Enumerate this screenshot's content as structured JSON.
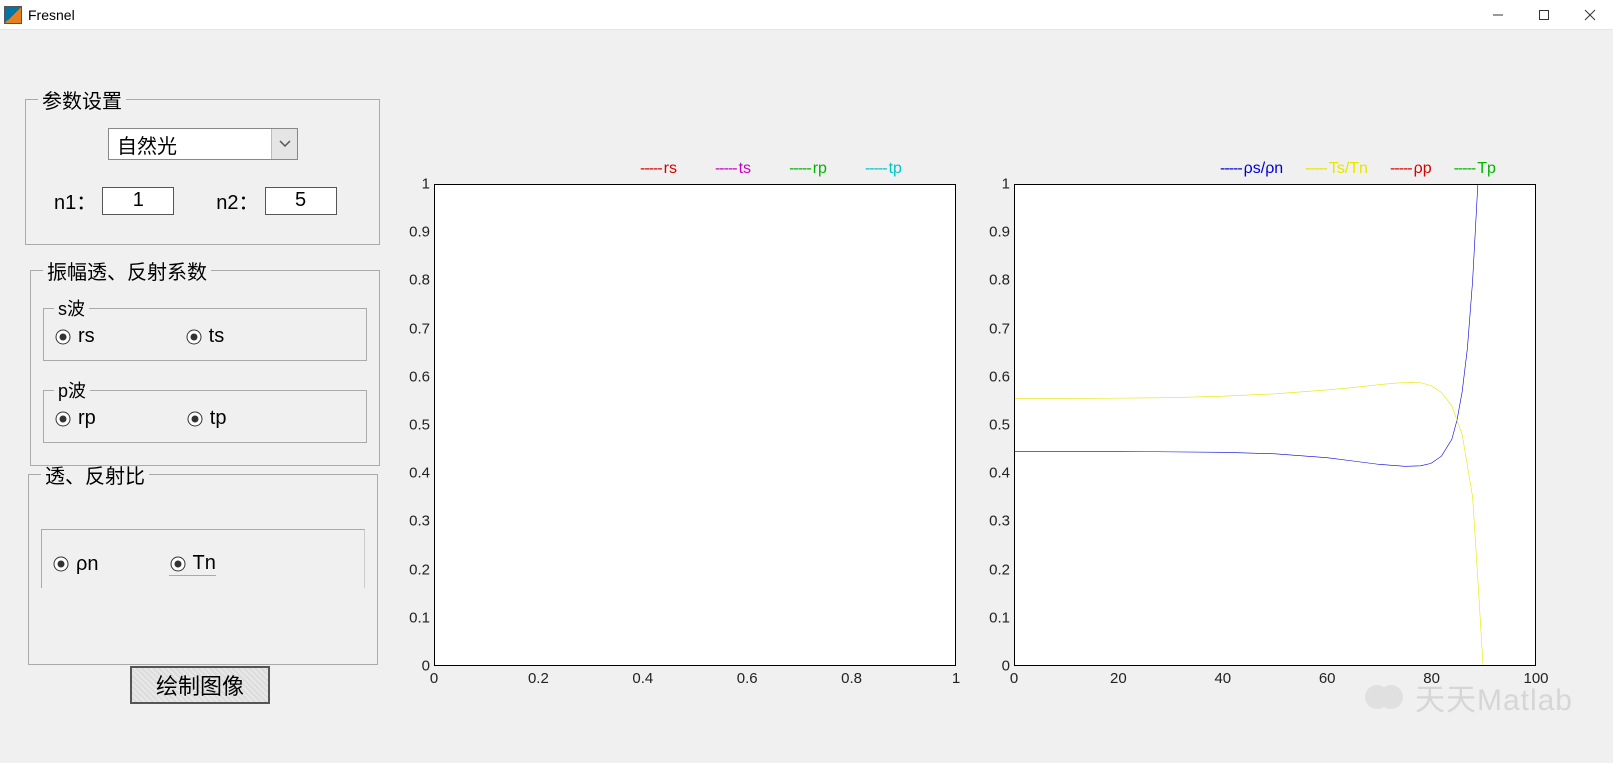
{
  "window": {
    "title": "Fresnel"
  },
  "params": {
    "legend": "参数设置",
    "light_type": "自然光",
    "n1_label": "n1：",
    "n1_value": "1",
    "n2_label": "n2：",
    "n2_value": "5"
  },
  "amp": {
    "legend": "振幅透、反射系数",
    "s_legend": "s波",
    "p_legend": "p波",
    "rs": "rs",
    "ts": "ts",
    "rp": "rp",
    "tp": "tp"
  },
  "ratio": {
    "legend": "透、反射比",
    "rho_n": "ρn",
    "Tn": "Tn"
  },
  "button": {
    "plot": "绘制图像"
  },
  "axes1": {
    "xticks": [
      "0",
      "0.2",
      "0.4",
      "0.6",
      "0.8",
      "1"
    ],
    "yticks": [
      "0",
      "0.1",
      "0.2",
      "0.3",
      "0.4",
      "0.5",
      "0.6",
      "0.7",
      "0.8",
      "0.9",
      "1"
    ],
    "legend": [
      {
        "label": "rs",
        "color": "#d80000"
      },
      {
        "label": "ts",
        "color": "#c400c4"
      },
      {
        "label": "rp",
        "color": "#00b400"
      },
      {
        "label": "tp",
        "color": "#00c5c5"
      }
    ]
  },
  "axes2": {
    "xticks": [
      "0",
      "20",
      "40",
      "60",
      "80",
      "100"
    ],
    "yticks": [
      "0",
      "0.1",
      "0.2",
      "0.3",
      "0.4",
      "0.5",
      "0.6",
      "0.7",
      "0.8",
      "0.9",
      "1"
    ],
    "legend": [
      {
        "label": "ρs/ρn",
        "color": "#0000d8"
      },
      {
        "label": "Ts/Tn",
        "color": "#e6e600"
      },
      {
        "label": "ρp",
        "color": "#d80000"
      },
      {
        "label": "Tp",
        "color": "#00b400"
      }
    ]
  },
  "watermark": "天天Matlab",
  "chart_data": [
    {
      "type": "line",
      "title": "",
      "xlabel": "",
      "ylabel": "",
      "xlim": [
        0,
        1
      ],
      "ylim": [
        0,
        1
      ],
      "series": []
    },
    {
      "type": "line",
      "title": "",
      "xlabel": "",
      "ylabel": "",
      "xlim": [
        0,
        100
      ],
      "ylim": [
        0,
        1
      ],
      "series": [
        {
          "name": "ρs/ρn",
          "color": "#0000d8",
          "x": [
            0,
            10,
            20,
            30,
            40,
            50,
            60,
            65,
            70,
            75,
            78,
            80,
            82,
            84,
            85,
            86,
            87,
            88,
            89
          ],
          "y": [
            0.445,
            0.445,
            0.445,
            0.444,
            0.443,
            0.44,
            0.432,
            0.425,
            0.418,
            0.414,
            0.415,
            0.42,
            0.435,
            0.47,
            0.51,
            0.57,
            0.66,
            0.8,
            1.0
          ]
        },
        {
          "name": "Ts/Tn",
          "color": "#e6e600",
          "x": [
            0,
            10,
            20,
            30,
            40,
            50,
            60,
            65,
            70,
            72,
            74,
            76,
            78,
            80,
            82,
            84,
            86,
            88,
            89,
            90
          ],
          "y": [
            0.555,
            0.555,
            0.556,
            0.557,
            0.56,
            0.565,
            0.573,
            0.578,
            0.584,
            0.586,
            0.588,
            0.589,
            0.588,
            0.582,
            0.568,
            0.54,
            0.48,
            0.35,
            0.18,
            0.0
          ]
        }
      ]
    }
  ]
}
